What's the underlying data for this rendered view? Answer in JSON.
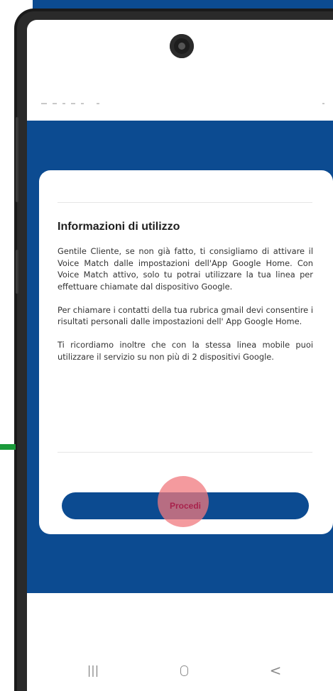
{
  "dialog": {
    "title": "Informazioni di utilizzo",
    "paragraphs": [
      "Gentile Cliente, se non già fatto, ti consigliamo di attivare il Voice Match dalle impostazioni dell'App Google Home. Con Voice Match attivo, solo tu potrai utilizzare la tua linea per effettuare chiamate dal dispositivo Google.",
      "Per chiamare i contatti della tua rubrica gmail devi consentire i risultati personali dalle impostazioni dell' App Google Home.",
      "Ti ricordiamo inoltre che con la stessa linea mobile puoi utilizzare il servizio su non più di 2 dispositivi Google."
    ],
    "primary_button_label": "Procedi"
  },
  "nav_bar": {
    "recents_glyph": "|||",
    "back_glyph": "<",
    "icons": [
      "recents-icon",
      "home-icon",
      "back-icon"
    ]
  },
  "colors": {
    "brand_blue": "#0c4b91",
    "card_background": "#ffffff",
    "tap_indicator": "#f0787d",
    "button_text": "#a8224c"
  }
}
